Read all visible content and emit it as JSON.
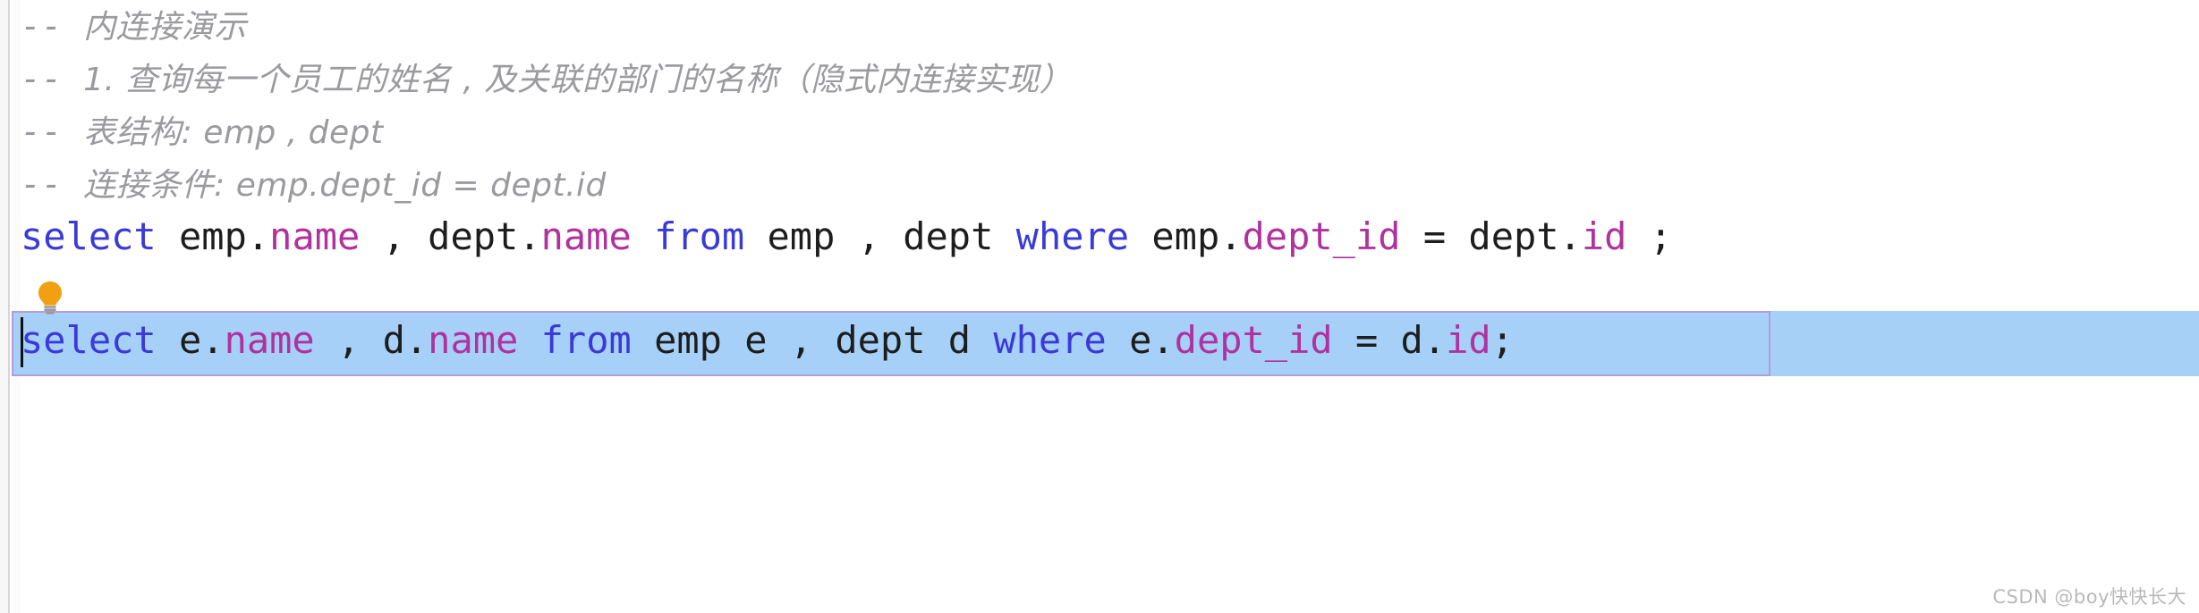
{
  "editor": {
    "comments": [
      {
        "dashes": "-- ",
        "text": "内连接演示"
      },
      {
        "dashes": "-- ",
        "text": "1. 查询每一个员工的姓名 , 及关联的部门的名称（隐式内连接实现）"
      },
      {
        "dashes": "-- ",
        "text": "表结构: emp , dept"
      },
      {
        "dashes": "-- ",
        "text": "连接条件: emp.dept_id = dept.id"
      }
    ],
    "sql_line_1": {
      "full_text": "select emp.name , dept.name from emp , dept where emp.dept_id = dept.id ;",
      "t1": "select",
      "t2": " emp.",
      "t3": "name",
      "t4": " , dept.",
      "t5": "name",
      "t6": " ",
      "t7": "from",
      "t8": " emp , dept ",
      "t9": "where",
      "t10": " emp.",
      "t11": "dept_id",
      "t12": " = dept.",
      "t13": "id",
      "t14": " ;"
    },
    "sql_line_2": {
      "full_text": "select e.name , d.name from emp e , dept d where e.dept_id = d.id;",
      "t1": "select",
      "t2": " e.",
      "t3": "name",
      "t4": " , d.",
      "t5": "name",
      "t6": " ",
      "t7": "from",
      "t8": " emp e , dept d ",
      "t9": "where",
      "t10": " e.",
      "t11": "dept_id",
      "t12": " = d.",
      "t13": "id",
      "t14": ";"
    },
    "intention_bulb": "lightbulb-icon",
    "watermark": "CSDN @boy快快长大",
    "colors": {
      "keyword": "#3a3ad8",
      "property": "#b0329e",
      "plain": "#1d1d1d",
      "comment": "#9a9a9f",
      "selection_bg": "#a7d0f7",
      "selection_border": "#b39ddb",
      "bulb": "#f0a010",
      "background": "#ffffff"
    }
  }
}
